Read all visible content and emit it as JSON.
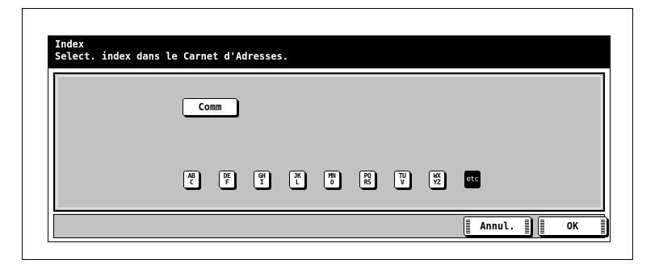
{
  "header": {
    "title": "Index",
    "subtitle": "Select. index dans le Carnet d'Adresses."
  },
  "buttons": {
    "common": "Comm",
    "cancel": "Annul.",
    "ok": "OK"
  },
  "index_keys": [
    {
      "line1": "AB",
      "line2": "C"
    },
    {
      "line1": "DE",
      "line2": "F"
    },
    {
      "line1": "GH",
      "line2": "I"
    },
    {
      "line1": "JK",
      "line2": "L"
    },
    {
      "line1": "MN",
      "line2": "O"
    },
    {
      "line1": "PQ",
      "line2": "RS"
    },
    {
      "line1": "TU",
      "line2": "V"
    },
    {
      "line1": "WX",
      "line2": "YZ"
    },
    {
      "line1": "etc",
      "line2": "",
      "selected": true
    }
  ]
}
